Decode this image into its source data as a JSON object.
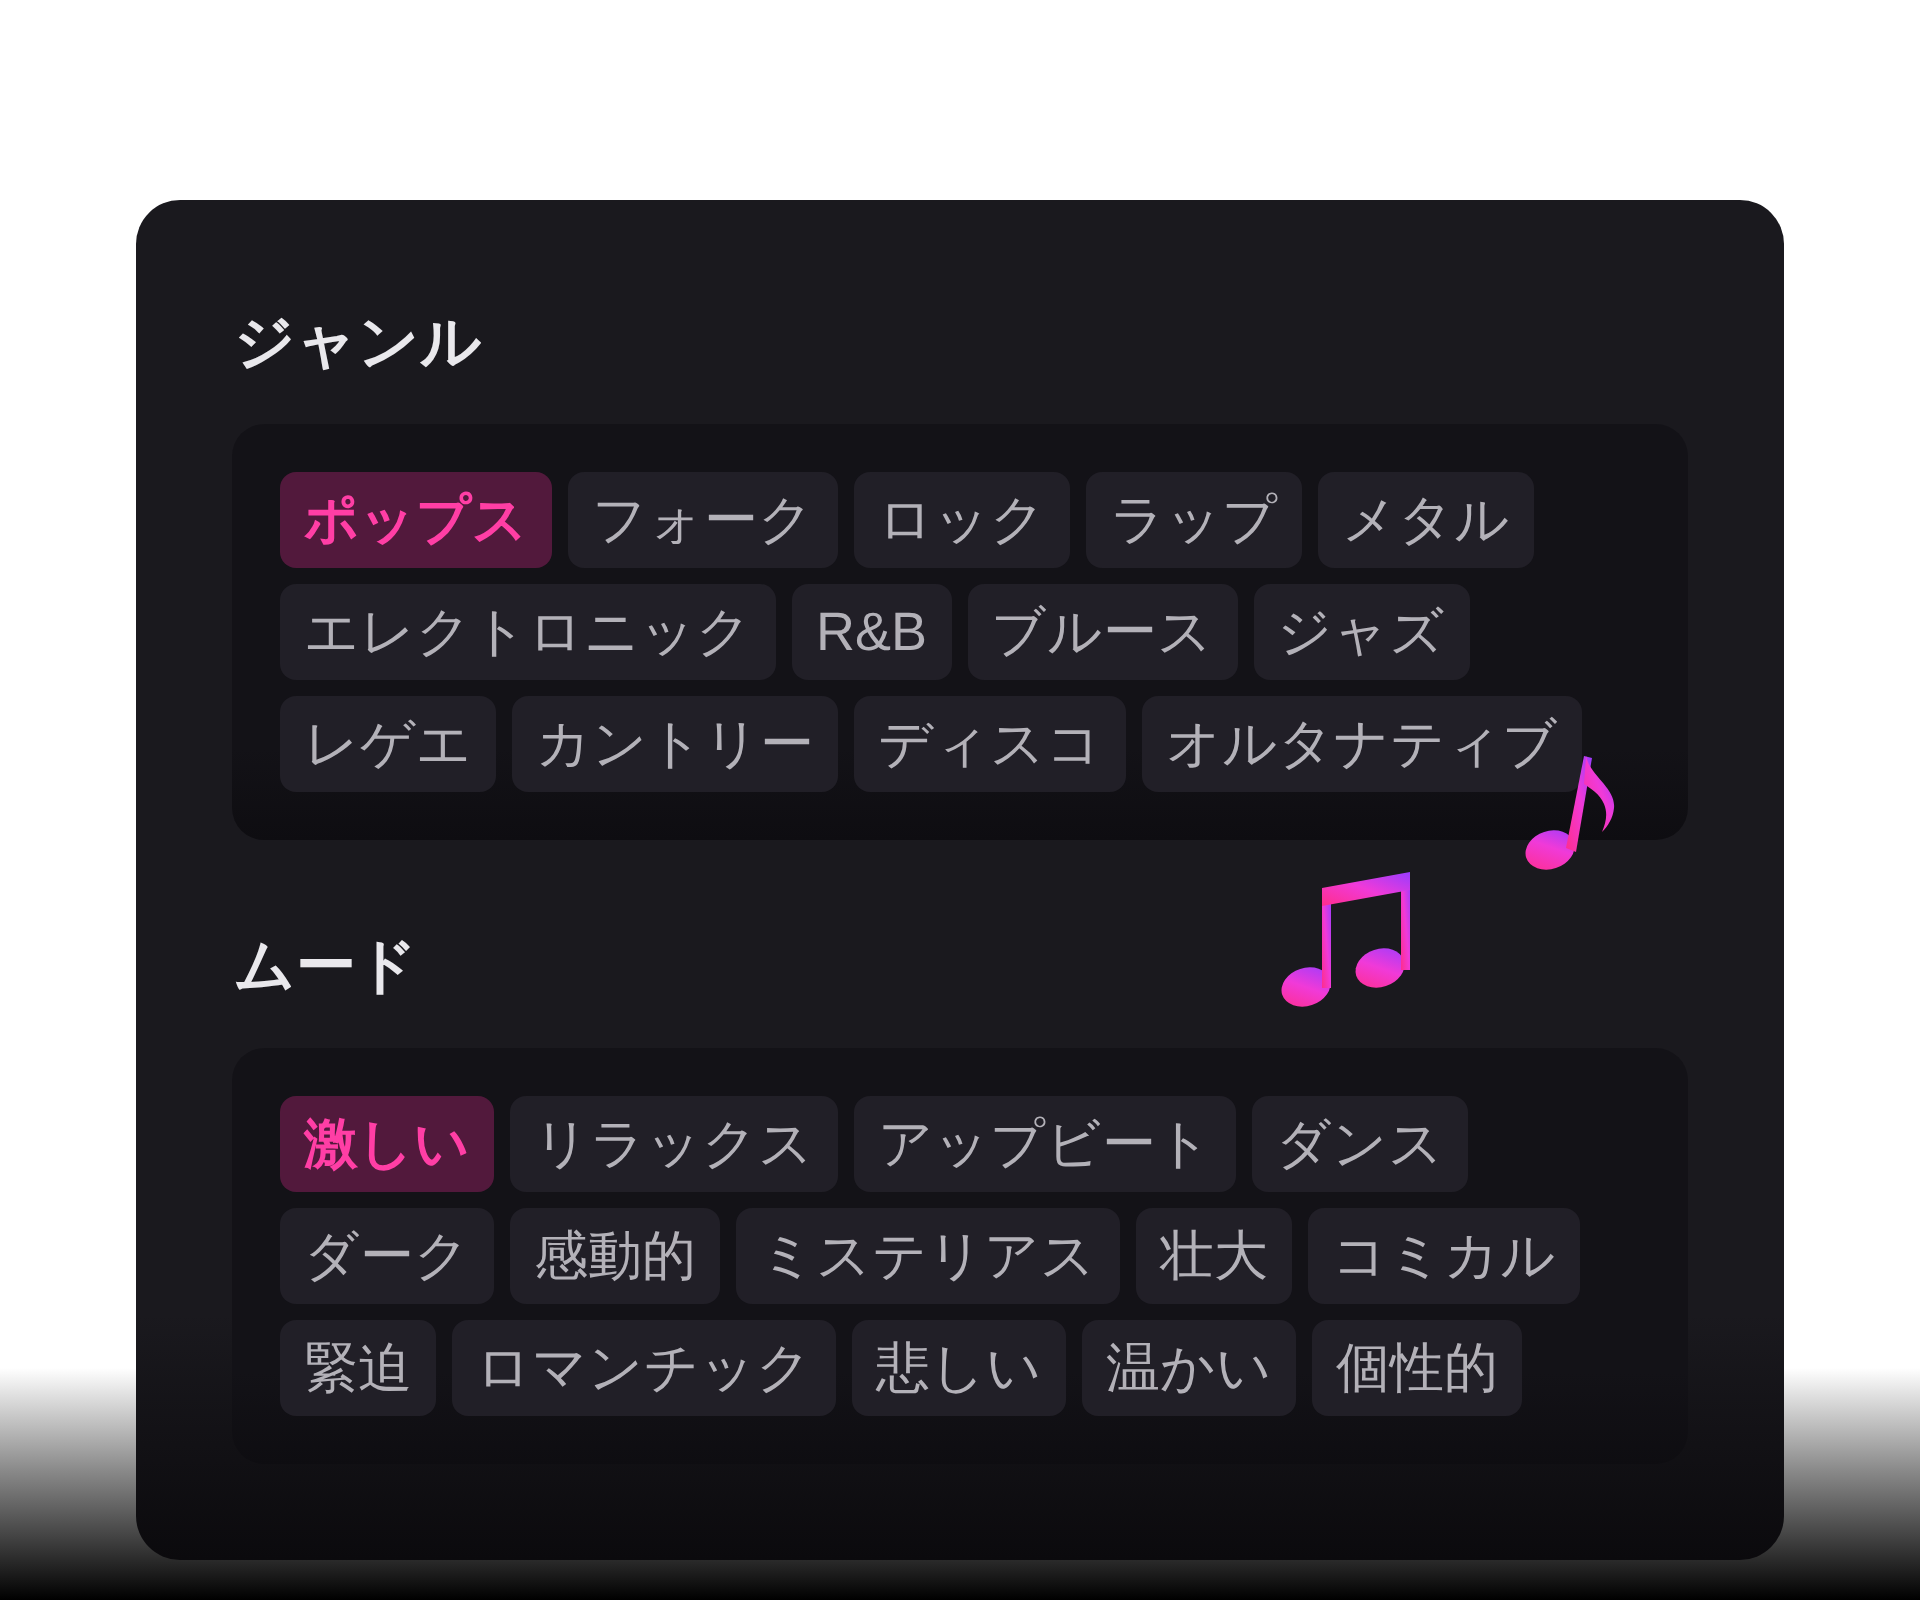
{
  "sections": [
    {
      "title": "ジャンル",
      "tags": [
        {
          "label": "ポップス",
          "selected": true
        },
        {
          "label": "フォーク",
          "selected": false
        },
        {
          "label": "ロック",
          "selected": false
        },
        {
          "label": "ラップ",
          "selected": false
        },
        {
          "label": "メタル",
          "selected": false
        },
        {
          "label": "エレクトロニック",
          "selected": false
        },
        {
          "label": "R&B",
          "selected": false
        },
        {
          "label": "ブルース",
          "selected": false
        },
        {
          "label": "ジャズ",
          "selected": false
        },
        {
          "label": "レゲエ",
          "selected": false
        },
        {
          "label": "カントリー",
          "selected": false
        },
        {
          "label": "ディスコ",
          "selected": false
        },
        {
          "label": "オルタナティブ",
          "selected": false
        }
      ]
    },
    {
      "title": "ムード",
      "tags": [
        {
          "label": "激しい",
          "selected": true
        },
        {
          "label": "リラックス",
          "selected": false
        },
        {
          "label": "アップビート",
          "selected": false
        },
        {
          "label": "ダンス",
          "selected": false
        },
        {
          "label": "ダーク",
          "selected": false
        },
        {
          "label": "感動的",
          "selected": false
        },
        {
          "label": "ミステリアス",
          "selected": false
        },
        {
          "label": "壮大",
          "selected": false
        },
        {
          "label": "コミカル",
          "selected": false
        },
        {
          "label": "緊迫",
          "selected": false
        },
        {
          "label": "ロマンチック",
          "selected": false
        },
        {
          "label": "悲しい",
          "selected": false
        },
        {
          "label": "温かい",
          "selected": false
        },
        {
          "label": "個性的",
          "selected": false
        }
      ]
    }
  ]
}
